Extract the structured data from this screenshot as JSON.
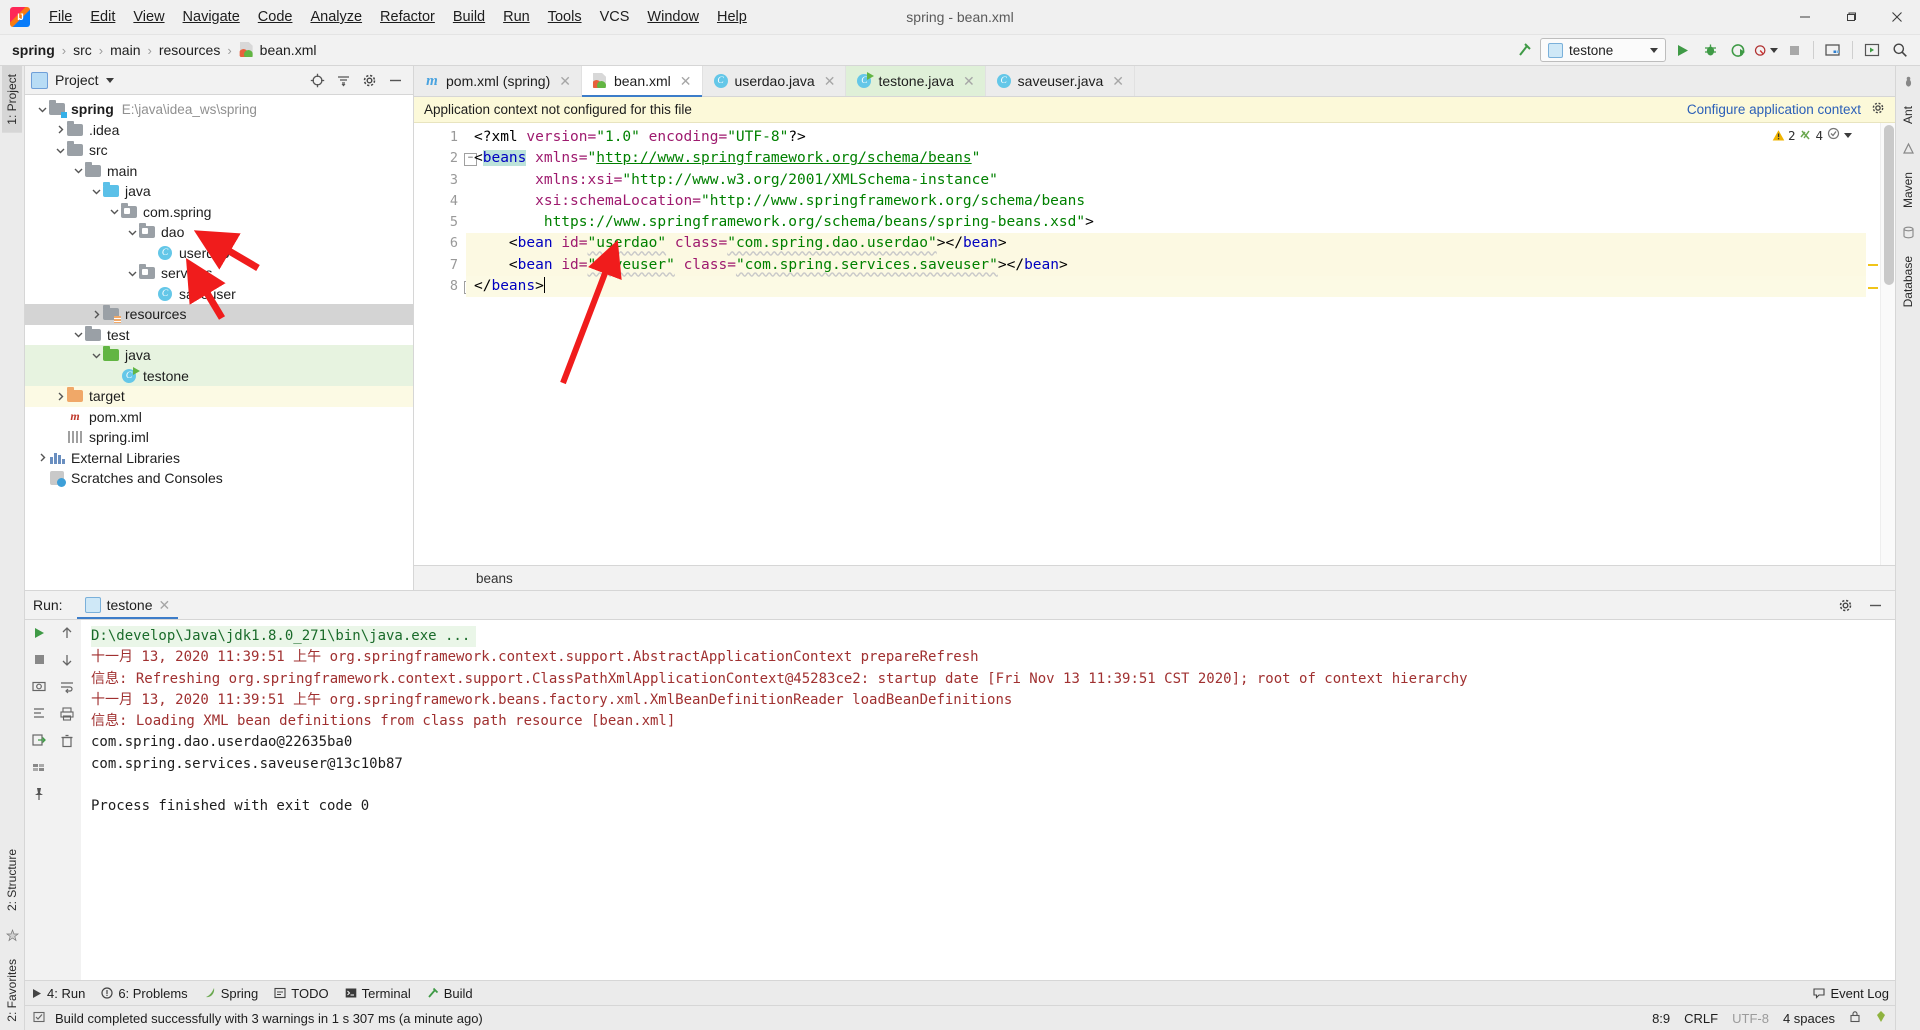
{
  "window": {
    "title": "spring - bean.xml",
    "app_icon": "intellij-idea-logo",
    "minimize": "─",
    "maximize": "❐",
    "close": "✕"
  },
  "menubar": {
    "items": [
      {
        "label": "File"
      },
      {
        "label": "Edit"
      },
      {
        "label": "View"
      },
      {
        "label": "Navigate"
      },
      {
        "label": "Code"
      },
      {
        "label": "Analyze"
      },
      {
        "label": "Refactor"
      },
      {
        "label": "Build"
      },
      {
        "label": "Run"
      },
      {
        "label": "Tools"
      },
      {
        "label": "VCS"
      },
      {
        "label": "Window"
      },
      {
        "label": "Help"
      }
    ]
  },
  "navbar": {
    "breadcrumbs": [
      "spring",
      "src",
      "main",
      "resources",
      "bean.xml"
    ],
    "separator": "›",
    "run_config": "testone",
    "buttons": [
      {
        "name": "build-hammer-icon"
      },
      {
        "name": "run-button"
      },
      {
        "name": "debug-button"
      },
      {
        "name": "run-with-coverage-button"
      },
      {
        "name": "profile-button"
      },
      {
        "name": "stop-button"
      },
      {
        "name": "project-structure-button"
      },
      {
        "name": "preferences-button"
      },
      {
        "name": "search-everywhere-button"
      }
    ]
  },
  "left_rail": {
    "tabs": [
      "1: Project",
      "2: Structure",
      "2: Favorites"
    ]
  },
  "right_rail": {
    "tabs": [
      "Ant",
      "Maven",
      "Database"
    ]
  },
  "project_panel": {
    "title": "Project",
    "toolbar": [
      {
        "name": "locate-target-icon"
      },
      {
        "name": "collapse-all-icon"
      },
      {
        "name": "settings-gear-icon"
      },
      {
        "name": "hide-icon"
      }
    ],
    "tree": [
      {
        "depth": 0,
        "label": "spring",
        "path": "E:\\java\\idea_ws\\spring",
        "icon": "module-folder",
        "arrow": "down",
        "bold": true,
        "state": ""
      },
      {
        "depth": 1,
        "label": ".idea",
        "path": "",
        "icon": "folder-gray",
        "arrow": "right",
        "bold": false,
        "state": ""
      },
      {
        "depth": 1,
        "label": "src",
        "path": "",
        "icon": "folder-gray",
        "arrow": "down",
        "bold": false,
        "state": ""
      },
      {
        "depth": 2,
        "label": "main",
        "path": "",
        "icon": "folder-gray",
        "arrow": "down",
        "bold": false,
        "state": ""
      },
      {
        "depth": 3,
        "label": "java",
        "path": "",
        "icon": "folder-blue",
        "arrow": "down",
        "bold": false,
        "state": ""
      },
      {
        "depth": 4,
        "label": "com.spring",
        "path": "",
        "icon": "package",
        "arrow": "down",
        "bold": false,
        "state": ""
      },
      {
        "depth": 5,
        "label": "dao",
        "path": "",
        "icon": "package",
        "arrow": "down",
        "bold": false,
        "state": ""
      },
      {
        "depth": 6,
        "label": "userdao",
        "path": "",
        "icon": "java-class",
        "arrow": "none",
        "bold": false,
        "state": ""
      },
      {
        "depth": 5,
        "label": "services",
        "path": "",
        "icon": "package",
        "arrow": "down",
        "bold": false,
        "state": ""
      },
      {
        "depth": 6,
        "label": "saveuser",
        "path": "",
        "icon": "java-class",
        "arrow": "none",
        "bold": false,
        "state": ""
      },
      {
        "depth": 3,
        "label": "resources",
        "path": "",
        "icon": "folder-resources",
        "arrow": "right",
        "bold": false,
        "state": "sel-gray"
      },
      {
        "depth": 2,
        "label": "test",
        "path": "",
        "icon": "folder-gray",
        "arrow": "down",
        "bold": false,
        "state": ""
      },
      {
        "depth": 3,
        "label": "java",
        "path": "",
        "icon": "folder-green",
        "arrow": "down",
        "bold": false,
        "state": "sel-green"
      },
      {
        "depth": 4,
        "label": "testone",
        "path": "",
        "icon": "java-class-run",
        "arrow": "none",
        "bold": false,
        "state": "sel-green"
      },
      {
        "depth": 1,
        "label": "target",
        "path": "",
        "icon": "folder-orange",
        "arrow": "right",
        "bold": false,
        "state": "sel-yellow"
      },
      {
        "depth": 1,
        "label": "pom.xml",
        "path": "",
        "icon": "maven-file",
        "arrow": "none",
        "bold": false,
        "state": ""
      },
      {
        "depth": 1,
        "label": "spring.iml",
        "path": "",
        "icon": "iml-file",
        "arrow": "none",
        "bold": false,
        "state": ""
      },
      {
        "depth": 0,
        "label": "External Libraries",
        "path": "",
        "icon": "libraries",
        "arrow": "right",
        "bold": false,
        "state": ""
      },
      {
        "depth": 0,
        "label": "Scratches and Consoles",
        "path": "",
        "icon": "scratches",
        "arrow": "none",
        "bold": false,
        "state": ""
      }
    ]
  },
  "editor": {
    "tabs": [
      {
        "label": "pom.xml (spring)",
        "icon": "maven-icon",
        "active": false,
        "highlight": "none",
        "close": "✕"
      },
      {
        "label": "bean.xml",
        "icon": "spring-xml-icon",
        "active": true,
        "highlight": "none",
        "close": "✕"
      },
      {
        "label": "userdao.java",
        "icon": "java-class-icon",
        "active": false,
        "highlight": "none",
        "close": "✕"
      },
      {
        "label": "testone.java",
        "icon": "java-class-run-icon",
        "active": false,
        "highlight": "green",
        "close": "✕"
      },
      {
        "label": "saveuser.java",
        "icon": "java-class-icon",
        "active": false,
        "highlight": "none",
        "close": "✕"
      }
    ],
    "notification": {
      "message": "Application context not configured for this file",
      "link": "Configure application context",
      "gear": "settings-gear-icon"
    },
    "inspection": {
      "warning_count": "2",
      "weak_warning_count": "4",
      "warning_icon": "warning-triangle-icon",
      "weak_icon": "weak-warning-icon"
    },
    "line_numbers": [
      "1",
      "2",
      "3",
      "4",
      "5",
      "6",
      "7",
      "8"
    ],
    "breadcrumb_footer": "beans",
    "lines": [
      {
        "n": 1,
        "raw": "<?xml version=\"1.0\" encoding=\"UTF-8\"?>"
      },
      {
        "n": 2,
        "raw": "<beans xmlns=\"http://www.springframework.org/schema/beans\""
      },
      {
        "n": 3,
        "raw": "       xmlns:xsi=\"http://www.w3.org/2001/XMLSchema-instance\""
      },
      {
        "n": 4,
        "raw": "       xsi:schemaLocation=\"http://www.springframework.org/schema/beans"
      },
      {
        "n": 5,
        "raw": "        https://www.springframework.org/schema/beans/spring-beans.xsd\">"
      },
      {
        "n": 6,
        "raw": "    <bean id=\"userdao\" class=\"com.spring.dao.userdao\"></bean>"
      },
      {
        "n": 7,
        "raw": "    <bean id=\"saveuser\" class=\"com.spring.services.saveuser\"></bean>"
      },
      {
        "n": 8,
        "raw": "</beans>"
      }
    ]
  },
  "run_window": {
    "label": "Run:",
    "tab": "testone",
    "tab_close": "✕",
    "console_lines": [
      {
        "text": "D:\\develop\\Java\\jdk1.8.0_271\\bin\\java.exe ...",
        "style": "green"
      },
      {
        "text": "十一月 13, 2020 11:39:51 上午 org.springframework.context.support.AbstractApplicationContext prepareRefresh",
        "style": "red"
      },
      {
        "text": "信息: Refreshing org.springframework.context.support.ClassPathXmlApplicationContext@45283ce2: startup date [Fri Nov 13 11:39:51 CST 2020]; root of context hierarchy",
        "style": "red"
      },
      {
        "text": "十一月 13, 2020 11:39:51 上午 org.springframework.beans.factory.xml.XmlBeanDefinitionReader loadBeanDefinitions",
        "style": "red"
      },
      {
        "text": "信息: Loading XML bean definitions from class path resource [bean.xml]",
        "style": "red"
      },
      {
        "text": "com.spring.dao.userdao@22635ba0",
        "style": "black"
      },
      {
        "text": "com.spring.services.saveuser@13c10b87",
        "style": "black"
      },
      {
        "text": "",
        "style": "black"
      },
      {
        "text": "Process finished with exit code 0",
        "style": "black"
      }
    ]
  },
  "tool_strip": {
    "items": [
      {
        "label": "4: Run",
        "icon": "run-icon"
      },
      {
        "label": "6: Problems",
        "icon": "problems-icon"
      },
      {
        "label": "Spring",
        "icon": "spring-leaf-icon"
      },
      {
        "label": "TODO",
        "icon": "todo-icon"
      },
      {
        "label": "Terminal",
        "icon": "terminal-icon"
      },
      {
        "label": "Build",
        "icon": "build-icon"
      }
    ],
    "event_log": "Event Log",
    "event_log_icon": "balloon-icon"
  },
  "statusbar": {
    "message": "Build completed successfully with 3 warnings in 1 s 307 ms (a minute ago)",
    "message_icon": "build-status-icon",
    "caret_position": "8:9",
    "line_separator": "CRLF",
    "encoding": "UTF-8",
    "indent": "4 spaces",
    "lock_icon": "lock-icon",
    "hector_icon": "inspection-level-icon"
  },
  "annotations": {
    "arrows": [
      {
        "name": "arrow-to-userdao"
      },
      {
        "name": "arrow-to-saveuser"
      },
      {
        "name": "arrow-to-bean-line"
      }
    ],
    "color": "#f01c1c"
  },
  "colors": {
    "accent_blue": "#3d7dc9",
    "tab_active_underline": "#3d7dc9",
    "notification_bg": "#fcf9d9",
    "annotation_red": "#f01c1c",
    "selection_gray": "#d4d4d4",
    "test_green": "#e7f3e0"
  }
}
